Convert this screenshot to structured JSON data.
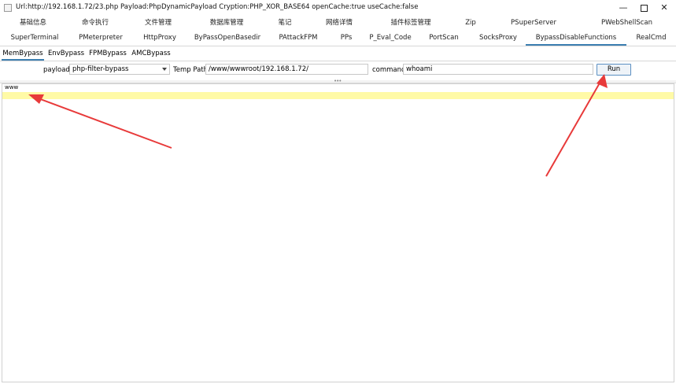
{
  "window": {
    "title": "Url:http://192.168.1.72/23.php Payload:PhpDynamicPayload Cryption:PHP_XOR_BASE64 openCache:true useCache:false",
    "min_glyph": "—",
    "close_glyph": "✕"
  },
  "tabs_row1": [
    "基础信息",
    "命令执行",
    "文件管理",
    "数据库管理",
    "笔记",
    "网络详情",
    "插件标签管理",
    "Zip",
    "PSuperServer",
    "PWebShellScan"
  ],
  "tabs_row2": [
    "SuperTerminal",
    "PMeterpreter",
    "HttpProxy",
    "ByPassOpenBasedir",
    "PAttackFPM",
    "PPs",
    "P_Eval_Code",
    "PortScan",
    "SocksProxy",
    "BypassDisableFunctions",
    "RealCmd"
  ],
  "selected_tab": "BypassDisableFunctions",
  "subtabs": [
    "MemBypass",
    "EnvBypass",
    "FPMBypass",
    "AMCBypass"
  ],
  "selected_subtab": "MemBypass",
  "form": {
    "payload_label": "payload",
    "payload_value": "php-filter-bypass",
    "temp_path_label": "Temp Path",
    "temp_path_value": "/www/wwwroot/192.168.1.72/",
    "command_label": "command",
    "command_value": "whoami",
    "run_label": "Run"
  },
  "output": {
    "line1": "www"
  },
  "colors": {
    "accent": "#3c7fb1",
    "highlight": "#fffaa6",
    "arrow": "#e83a3a"
  },
  "icons": [
    "app-icon",
    "minimize-icon",
    "maximize-icon",
    "close-icon",
    "dropdown-arrow-icon",
    "splitter-grip-icon"
  ]
}
